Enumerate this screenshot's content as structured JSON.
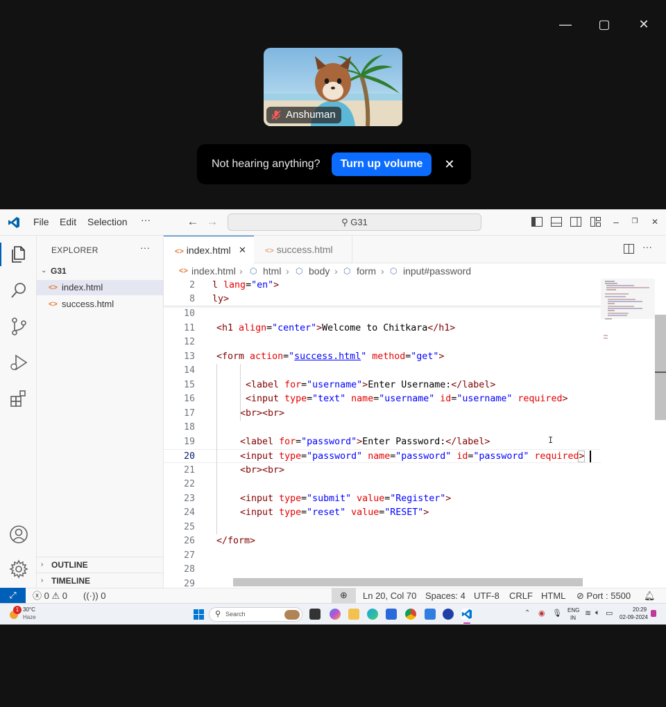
{
  "participant": {
    "name": "Anshuman"
  },
  "toast": {
    "message": "Not hearing anything?",
    "button": "Turn up volume",
    "close": "✕"
  },
  "window_controls": {
    "minimize": "—",
    "maximize": "▢",
    "close": "✕"
  },
  "vscode": {
    "menu": [
      "File",
      "Edit",
      "Selection",
      "···"
    ],
    "command_center": "G31",
    "explorer": {
      "title": "EXPLORER",
      "more": "···",
      "folder": "G31",
      "files": [
        "index.html",
        "success.html"
      ],
      "outline": "OUTLINE",
      "timeline": "TIMELINE"
    },
    "tabs": [
      {
        "label": "index.html",
        "active": true
      },
      {
        "label": "success.html",
        "active": false
      }
    ],
    "breadcrumb": [
      "index.html",
      "html",
      "body",
      "form",
      "input#password"
    ],
    "line_numbers": [
      "2",
      "8",
      "10",
      "11",
      "12",
      "13",
      "14",
      "15",
      "16",
      "17",
      "18",
      "19",
      "20",
      "21",
      "22",
      "23",
      "24",
      "25",
      "26",
      "27",
      "28",
      "29"
    ],
    "status": {
      "errors": "0",
      "warnings": "0",
      "ports": "0",
      "position": "Ln 20, Col 70",
      "spaces": "Spaces: 4",
      "encoding": "UTF-8",
      "eol": "CRLF",
      "language": "HTML",
      "live_server": "Port : 5500"
    }
  },
  "taskbar": {
    "weather_temp": "30°C",
    "weather_desc": "Haze",
    "weather_badge": "1",
    "search_placeholder": "Search",
    "lang_line1": "ENG",
    "lang_line2": "IN",
    "time": "20:29",
    "date": "02-09-2024"
  },
  "colors": {
    "accent_blue": "#0b6cff",
    "vscode_blue": "#005fb8",
    "tag": "#800000",
    "attr": "#e50000",
    "value": "#0000ff"
  }
}
